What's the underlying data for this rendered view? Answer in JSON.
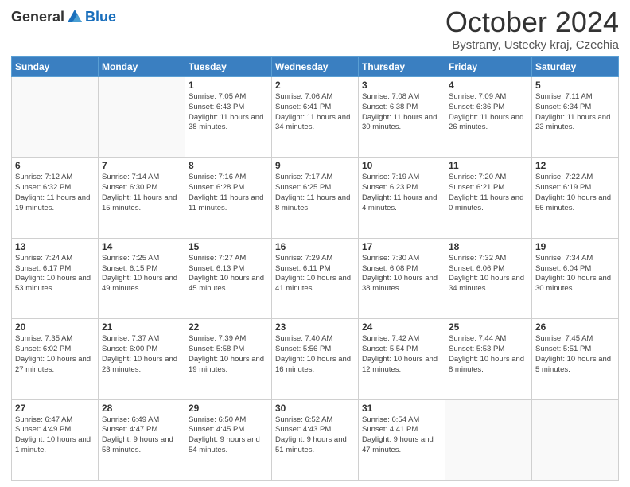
{
  "header": {
    "logo_general": "General",
    "logo_blue": "Blue",
    "month_title": "October 2024",
    "location": "Bystrany, Ustecky kraj, Czechia"
  },
  "calendar": {
    "days_of_week": [
      "Sunday",
      "Monday",
      "Tuesday",
      "Wednesday",
      "Thursday",
      "Friday",
      "Saturday"
    ],
    "weeks": [
      [
        {
          "day": "",
          "info": ""
        },
        {
          "day": "",
          "info": ""
        },
        {
          "day": "1",
          "info": "Sunrise: 7:05 AM\nSunset: 6:43 PM\nDaylight: 11 hours and 38 minutes."
        },
        {
          "day": "2",
          "info": "Sunrise: 7:06 AM\nSunset: 6:41 PM\nDaylight: 11 hours and 34 minutes."
        },
        {
          "day": "3",
          "info": "Sunrise: 7:08 AM\nSunset: 6:38 PM\nDaylight: 11 hours and 30 minutes."
        },
        {
          "day": "4",
          "info": "Sunrise: 7:09 AM\nSunset: 6:36 PM\nDaylight: 11 hours and 26 minutes."
        },
        {
          "day": "5",
          "info": "Sunrise: 7:11 AM\nSunset: 6:34 PM\nDaylight: 11 hours and 23 minutes."
        }
      ],
      [
        {
          "day": "6",
          "info": "Sunrise: 7:12 AM\nSunset: 6:32 PM\nDaylight: 11 hours and 19 minutes."
        },
        {
          "day": "7",
          "info": "Sunrise: 7:14 AM\nSunset: 6:30 PM\nDaylight: 11 hours and 15 minutes."
        },
        {
          "day": "8",
          "info": "Sunrise: 7:16 AM\nSunset: 6:28 PM\nDaylight: 11 hours and 11 minutes."
        },
        {
          "day": "9",
          "info": "Sunrise: 7:17 AM\nSunset: 6:25 PM\nDaylight: 11 hours and 8 minutes."
        },
        {
          "day": "10",
          "info": "Sunrise: 7:19 AM\nSunset: 6:23 PM\nDaylight: 11 hours and 4 minutes."
        },
        {
          "day": "11",
          "info": "Sunrise: 7:20 AM\nSunset: 6:21 PM\nDaylight: 11 hours and 0 minutes."
        },
        {
          "day": "12",
          "info": "Sunrise: 7:22 AM\nSunset: 6:19 PM\nDaylight: 10 hours and 56 minutes."
        }
      ],
      [
        {
          "day": "13",
          "info": "Sunrise: 7:24 AM\nSunset: 6:17 PM\nDaylight: 10 hours and 53 minutes."
        },
        {
          "day": "14",
          "info": "Sunrise: 7:25 AM\nSunset: 6:15 PM\nDaylight: 10 hours and 49 minutes."
        },
        {
          "day": "15",
          "info": "Sunrise: 7:27 AM\nSunset: 6:13 PM\nDaylight: 10 hours and 45 minutes."
        },
        {
          "day": "16",
          "info": "Sunrise: 7:29 AM\nSunset: 6:11 PM\nDaylight: 10 hours and 41 minutes."
        },
        {
          "day": "17",
          "info": "Sunrise: 7:30 AM\nSunset: 6:08 PM\nDaylight: 10 hours and 38 minutes."
        },
        {
          "day": "18",
          "info": "Sunrise: 7:32 AM\nSunset: 6:06 PM\nDaylight: 10 hours and 34 minutes."
        },
        {
          "day": "19",
          "info": "Sunrise: 7:34 AM\nSunset: 6:04 PM\nDaylight: 10 hours and 30 minutes."
        }
      ],
      [
        {
          "day": "20",
          "info": "Sunrise: 7:35 AM\nSunset: 6:02 PM\nDaylight: 10 hours and 27 minutes."
        },
        {
          "day": "21",
          "info": "Sunrise: 7:37 AM\nSunset: 6:00 PM\nDaylight: 10 hours and 23 minutes."
        },
        {
          "day": "22",
          "info": "Sunrise: 7:39 AM\nSunset: 5:58 PM\nDaylight: 10 hours and 19 minutes."
        },
        {
          "day": "23",
          "info": "Sunrise: 7:40 AM\nSunset: 5:56 PM\nDaylight: 10 hours and 16 minutes."
        },
        {
          "day": "24",
          "info": "Sunrise: 7:42 AM\nSunset: 5:54 PM\nDaylight: 10 hours and 12 minutes."
        },
        {
          "day": "25",
          "info": "Sunrise: 7:44 AM\nSunset: 5:53 PM\nDaylight: 10 hours and 8 minutes."
        },
        {
          "day": "26",
          "info": "Sunrise: 7:45 AM\nSunset: 5:51 PM\nDaylight: 10 hours and 5 minutes."
        }
      ],
      [
        {
          "day": "27",
          "info": "Sunrise: 6:47 AM\nSunset: 4:49 PM\nDaylight: 10 hours and 1 minute."
        },
        {
          "day": "28",
          "info": "Sunrise: 6:49 AM\nSunset: 4:47 PM\nDaylight: 9 hours and 58 minutes."
        },
        {
          "day": "29",
          "info": "Sunrise: 6:50 AM\nSunset: 4:45 PM\nDaylight: 9 hours and 54 minutes."
        },
        {
          "day": "30",
          "info": "Sunrise: 6:52 AM\nSunset: 4:43 PM\nDaylight: 9 hours and 51 minutes."
        },
        {
          "day": "31",
          "info": "Sunrise: 6:54 AM\nSunset: 4:41 PM\nDaylight: 9 hours and 47 minutes."
        },
        {
          "day": "",
          "info": ""
        },
        {
          "day": "",
          "info": ""
        }
      ]
    ]
  }
}
